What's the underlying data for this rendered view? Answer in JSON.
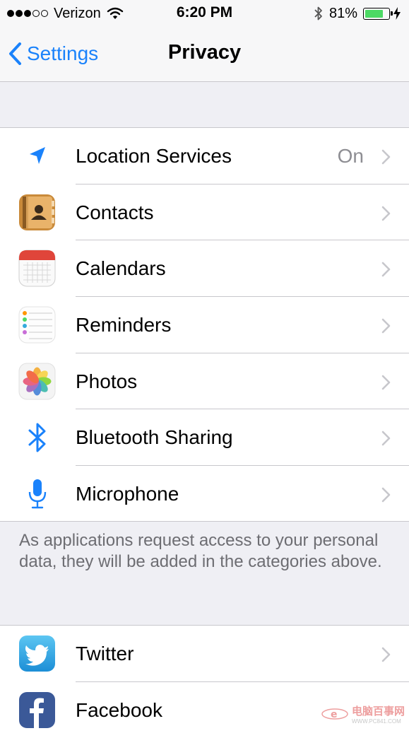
{
  "status_bar": {
    "carrier": "Verizon",
    "time": "6:20 PM",
    "battery_percent": "81%",
    "battery_level": 0.81,
    "signal_bars_filled": 3,
    "signal_bars_total": 5
  },
  "nav": {
    "back_label": "Settings",
    "title": "Privacy"
  },
  "privacy_items": [
    {
      "label": "Location Services",
      "value": "On",
      "icon": "location-arrow-icon"
    },
    {
      "label": "Contacts",
      "icon": "contacts-icon"
    },
    {
      "label": "Calendars",
      "icon": "calendar-icon"
    },
    {
      "label": "Reminders",
      "icon": "reminders-icon"
    },
    {
      "label": "Photos",
      "icon": "photos-icon"
    },
    {
      "label": "Bluetooth Sharing",
      "icon": "bluetooth-icon"
    },
    {
      "label": "Microphone",
      "icon": "microphone-icon"
    }
  ],
  "footer_note": "As applications request access to your personal data, they will be added in the categories above.",
  "social_items": [
    {
      "label": "Twitter",
      "icon": "twitter-icon"
    },
    {
      "label": "Facebook",
      "icon": "facebook-icon"
    }
  ],
  "watermark": {
    "text": "电脑百事网",
    "sub": "WWW.PC841.COM"
  },
  "colors": {
    "accent": "#1a82fb",
    "background": "#efeff4",
    "separator": "#c8c7cc",
    "secondary_text": "#8e8e93",
    "battery_fill": "#4cd964"
  }
}
